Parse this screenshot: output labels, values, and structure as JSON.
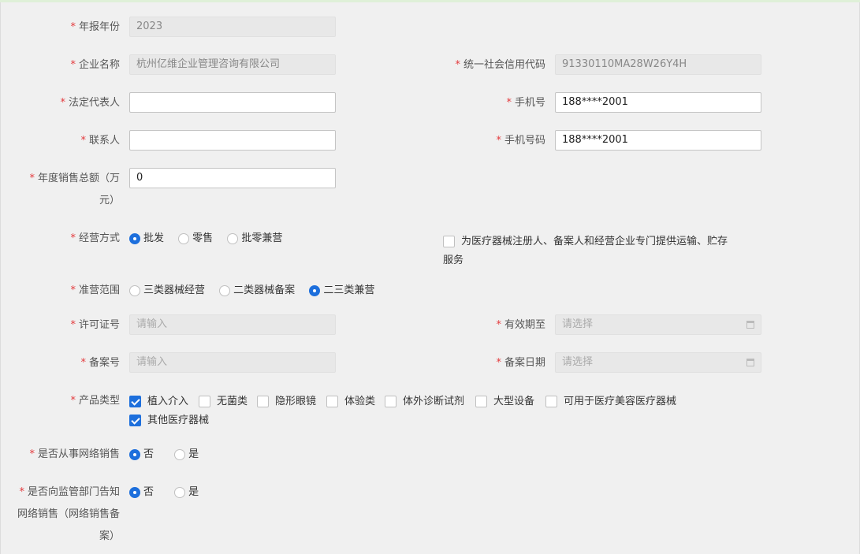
{
  "colors": {
    "required_star": "#e4393c",
    "accent": "#1d6fdc",
    "top_bar": "#dff0d8"
  },
  "fields": {
    "year": {
      "label": "年报年份",
      "value": "2023"
    },
    "company_name": {
      "label": "企业名称",
      "value": "杭州亿维企业管理咨询有限公司"
    },
    "credit_code": {
      "label": "统一社会信用代码",
      "value": "91330110MA28W26Y4H"
    },
    "legal_rep": {
      "label": "法定代表人",
      "value": ""
    },
    "phone": {
      "label": "手机号",
      "value": "188****2001"
    },
    "contact": {
      "label": "联系人",
      "value": ""
    },
    "contact_phone": {
      "label": "手机号码",
      "value": "188****2001"
    },
    "annual_sales": {
      "label_line1": "年度销售总额（万",
      "label_line2": "元）",
      "value": "0"
    },
    "business_mode": {
      "label": "经营方式",
      "options": [
        {
          "label": "批发",
          "selected": true
        },
        {
          "label": "零售",
          "selected": false
        },
        {
          "label": "批零兼营",
          "selected": false
        }
      ]
    },
    "logistics_service": {
      "line1": "为医疗器械注册人、备案人和经营企业专门提供运输、贮存",
      "line2": "服务",
      "checked": false
    },
    "business_scope": {
      "label": "准营范围",
      "options": [
        {
          "label": "三类器械经营",
          "selected": false
        },
        {
          "label": "二类器械备案",
          "selected": false
        },
        {
          "label": "二三类兼营",
          "selected": true
        }
      ]
    },
    "license_no": {
      "label": "许可证号",
      "placeholder": "请输入"
    },
    "valid_until": {
      "label": "有效期至",
      "placeholder": "请选择"
    },
    "record_no": {
      "label": "备案号",
      "placeholder": "请输入"
    },
    "record_date": {
      "label": "备案日期",
      "placeholder": "请选择"
    },
    "product_type": {
      "label": "产品类型",
      "options": [
        {
          "label": "植入介入",
          "checked": true
        },
        {
          "label": "无菌类",
          "checked": false
        },
        {
          "label": "隐形眼镜",
          "checked": false
        },
        {
          "label": "体验类",
          "checked": false
        },
        {
          "label": "体外诊断试剂",
          "checked": false
        },
        {
          "label": "大型设备",
          "checked": false
        },
        {
          "label": "可用于医疗美容医疗器械",
          "checked": false
        },
        {
          "label": "其他医疗器械",
          "checked": true
        }
      ]
    },
    "online_sales": {
      "label": "是否从事网络销售",
      "options": [
        {
          "label": "否",
          "selected": true
        },
        {
          "label": "是",
          "selected": false
        }
      ]
    },
    "notify_regulator": {
      "label_line1": "是否向监管部门告知",
      "label_line2": "网络销售（网络销售备",
      "label_line3": "案）",
      "options": [
        {
          "label": "否",
          "selected": true
        },
        {
          "label": "是",
          "selected": false
        }
      ]
    }
  },
  "required_mark": "*"
}
